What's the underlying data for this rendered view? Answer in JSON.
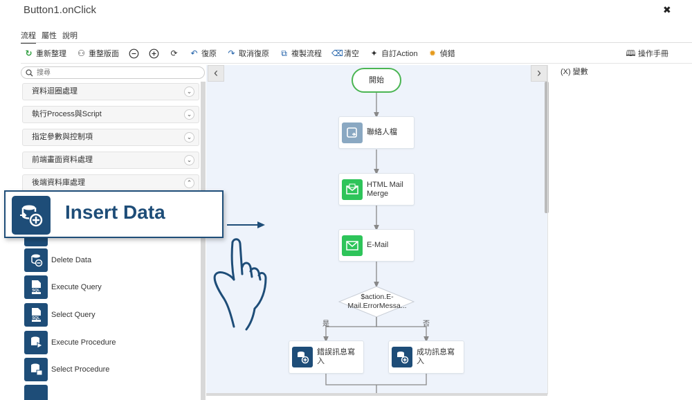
{
  "window": {
    "title": "Button1.onClick"
  },
  "tabs": [
    {
      "label": "流程"
    },
    {
      "label": "屬性"
    },
    {
      "label": "說明"
    }
  ],
  "toolbar": {
    "reorganize": "重新整理",
    "fit_layout": "重整版面",
    "undo": "復原",
    "redo": "取消復原",
    "copy_flow": "複製流程",
    "clear": "清空",
    "custom_action": "自訂Action",
    "debug": "偵錯",
    "manual": "操作手冊"
  },
  "search": {
    "placeholder": "搜尋"
  },
  "categories": [
    {
      "label": "資料迴圈處理"
    },
    {
      "label": "執行Process與Script"
    },
    {
      "label": "指定參數與控制項"
    },
    {
      "label": "前端畫面資料處理"
    },
    {
      "label": "後端資料庫處理"
    }
  ],
  "items": [
    {
      "label": "Delete Data"
    },
    {
      "label": "Execute Query"
    },
    {
      "label": "Select Query"
    },
    {
      "label": "Execute Procedure"
    },
    {
      "label": "Select Procedure"
    }
  ],
  "sql_badge": "SQL",
  "variables": {
    "label": "(X) 變數"
  },
  "flow": {
    "start": "開始",
    "contact": "聯絡人檔",
    "html_mail": "HTML Mail Merge",
    "email": "E-Mail",
    "condition": "$action.E-Mail.ErrorMessa...",
    "yes": "是",
    "no": "否",
    "error_insert": "錯誤訊息寫入",
    "success_insert": "成功訊息寫入"
  },
  "callout": {
    "text": "Insert Data"
  },
  "colors": {
    "brand": "#1e4d78",
    "green": "#4ab552",
    "canvas": "#eef3fb"
  }
}
